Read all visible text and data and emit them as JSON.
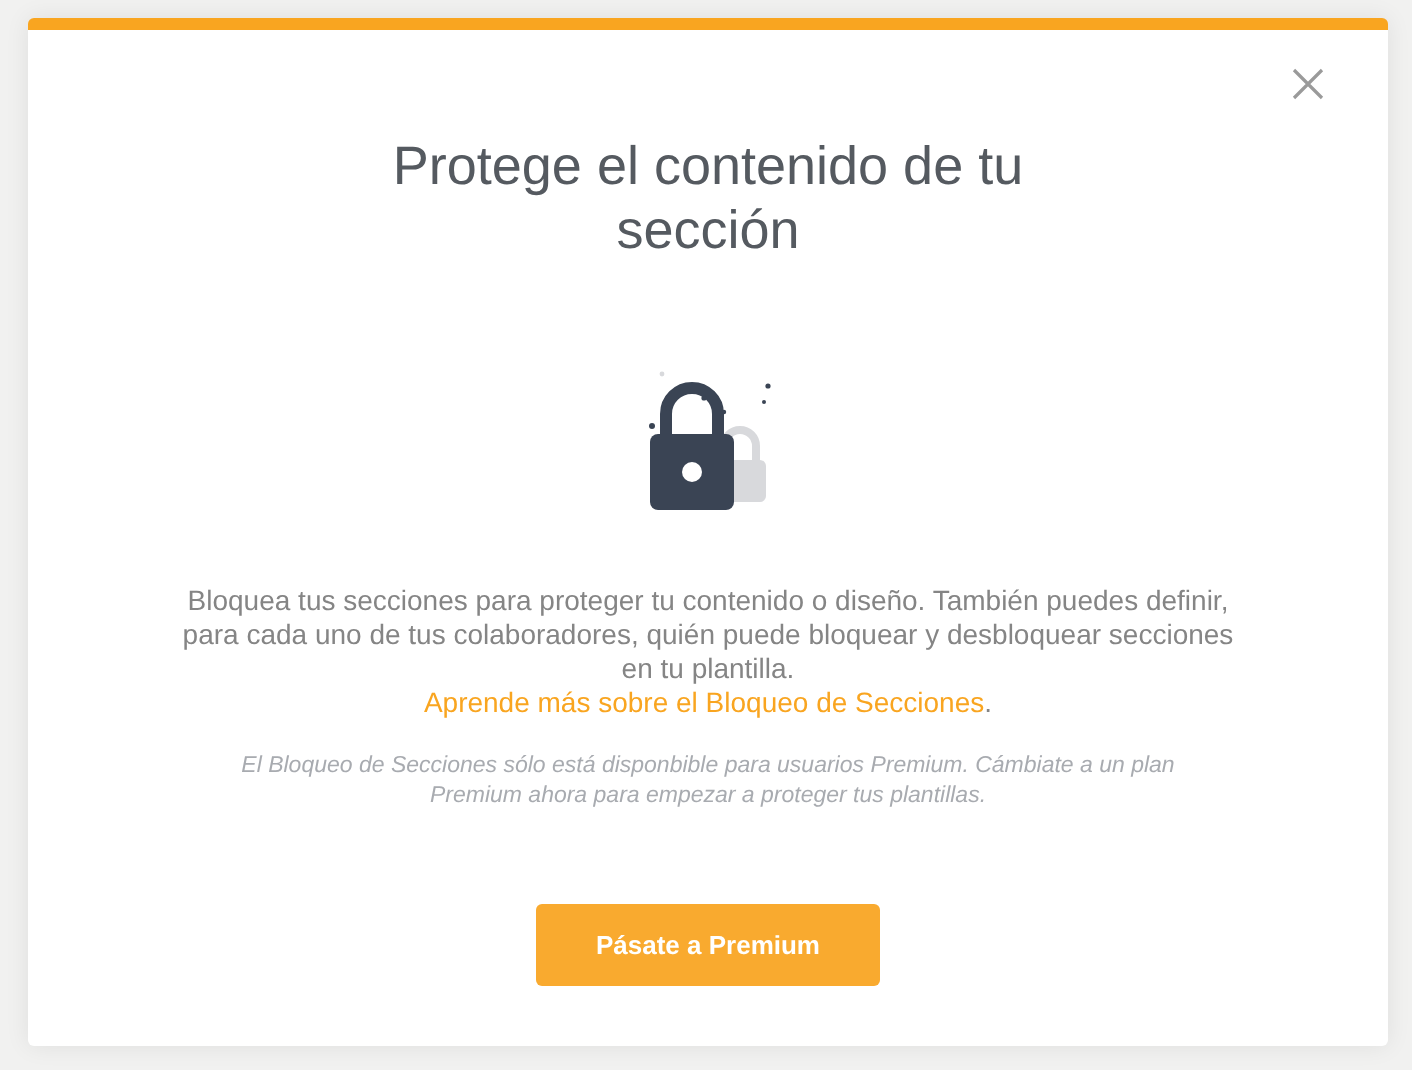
{
  "dialog": {
    "title": "Protege el contenido de tu sección",
    "description": "Bloquea tus secciones para proteger tu contenido o diseño. También puedes definir, para cada uno de tus colaboradores, quién puede bloquear y desbloquear secciones en tu plantilla.",
    "link": "Aprende más sobre el Bloqueo de Secciones",
    "link_suffix": ".",
    "note": "El Bloqueo de Secciones sólo está disponbible para usuarios Premium. Cámbiate a un plan Premium ahora para empezar a proteger tus plantillas.",
    "button": "Pásate a Premium"
  }
}
